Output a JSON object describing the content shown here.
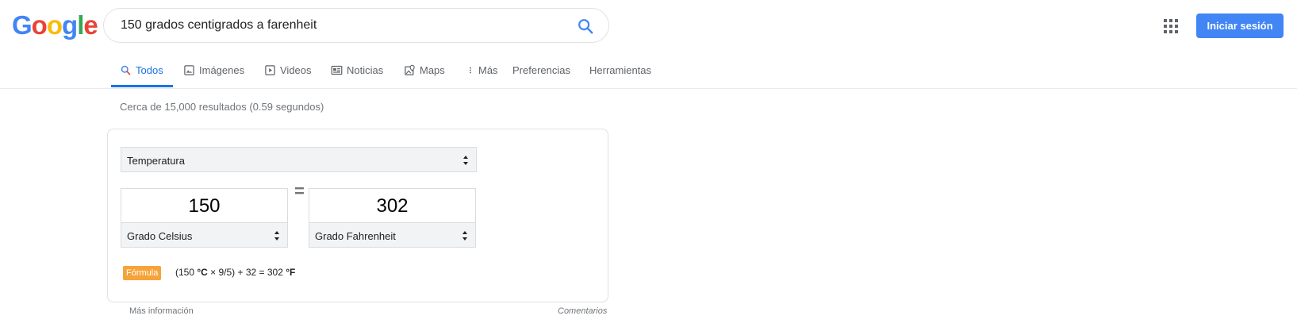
{
  "logo": {
    "letters": [
      {
        "ch": "G",
        "color": "#4285f4"
      },
      {
        "ch": "o",
        "color": "#ea4335"
      },
      {
        "ch": "o",
        "color": "#fbbc05"
      },
      {
        "ch": "g",
        "color": "#4285f4"
      },
      {
        "ch": "l",
        "color": "#34a853"
      },
      {
        "ch": "e",
        "color": "#ea4335"
      }
    ]
  },
  "search": {
    "query": "150 grados centigrados a farenheit"
  },
  "header": {
    "signin_label": "Iniciar sesión"
  },
  "tabs": [
    {
      "label": "Todos",
      "icon": "search-icon",
      "active": true
    },
    {
      "label": "Imágenes",
      "icon": "image-icon"
    },
    {
      "label": "Videos",
      "icon": "play-icon"
    },
    {
      "label": "Noticias",
      "icon": "news-icon"
    },
    {
      "label": "Maps",
      "icon": "map-pin-icon"
    },
    {
      "label": "Más",
      "icon": "more-vert-icon"
    },
    {
      "label": "Preferencias"
    },
    {
      "label": "Herramientas"
    }
  ],
  "stats": "Cerca de 15,000 resultados (0.59 segundos)",
  "converter": {
    "category": "Temperatura",
    "from": {
      "value": "150",
      "unit": "Grado Celsius"
    },
    "equals": "=",
    "to": {
      "value": "302",
      "unit": "Grado Fahrenheit"
    },
    "formula_label": "Fórmula",
    "formula": {
      "p1": "(150 ",
      "u1": "°C",
      "p2": " × 9/5) + 32 = 302 ",
      "u2": "°F"
    }
  },
  "footer": {
    "more_info": "Más información",
    "comments": "Comentarios"
  }
}
